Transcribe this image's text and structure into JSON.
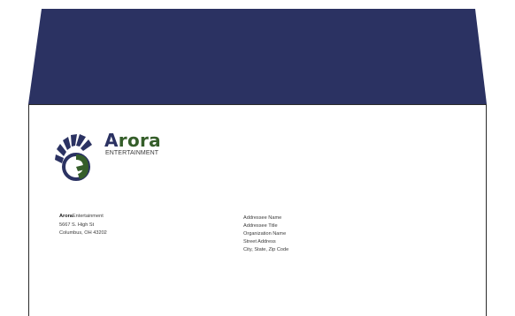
{
  "colors": {
    "flap": "#2b3262",
    "brand_blue": "#2b3262",
    "brand_green": "#355e2a",
    "paper": "#ffffff"
  },
  "logo": {
    "icon": "fan-swirl-logo-icon",
    "initial": "A",
    "rest": "rora",
    "tagline": "ENTERTAINMENT"
  },
  "return_address": {
    "name_bold": "Arora",
    "name_rest": "Entertainment",
    "street": "5667 S. High St",
    "city_line": "Columbus, OH 43202"
  },
  "recipient": {
    "lines": [
      "Addressee Name",
      "Addressee Title",
      "Organization Name",
      "Street Address",
      "City, State, Zip Code"
    ]
  }
}
